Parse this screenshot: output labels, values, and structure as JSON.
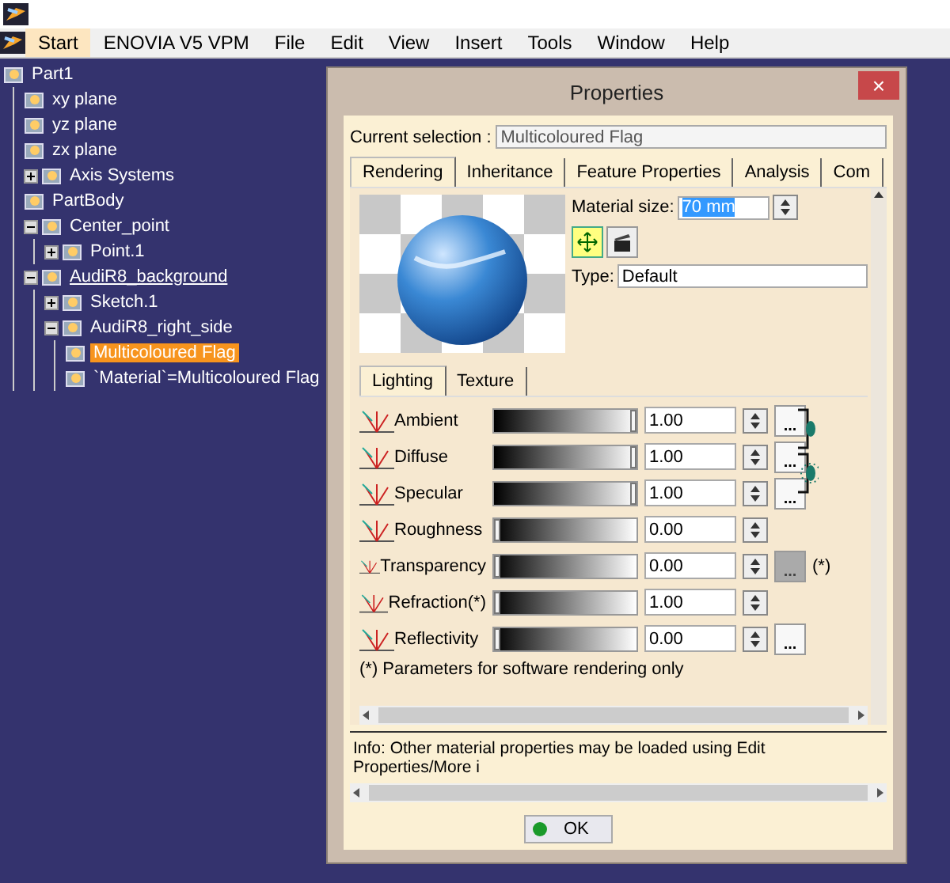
{
  "menubar": {
    "items": [
      {
        "label": "Start",
        "selected": true
      },
      {
        "label": "ENOVIA V5 VPM",
        "selected": false
      },
      {
        "label": "File",
        "selected": false
      },
      {
        "label": "Edit",
        "selected": false
      },
      {
        "label": "View",
        "selected": false
      },
      {
        "label": "Insert",
        "selected": false
      },
      {
        "label": "Tools",
        "selected": false
      },
      {
        "label": "Window",
        "selected": false
      },
      {
        "label": "Help",
        "selected": false
      }
    ]
  },
  "tree": [
    {
      "label": "Part1",
      "selected": false,
      "underlined": false,
      "children": [
        {
          "label": "xy plane",
          "selected": false,
          "underlined": false
        },
        {
          "label": "yz plane",
          "selected": false,
          "underlined": false
        },
        {
          "label": "zx plane",
          "selected": false,
          "underlined": false
        },
        {
          "label": "Axis Systems",
          "selected": false,
          "underlined": false,
          "expanded": false
        },
        {
          "label": "PartBody",
          "selected": false,
          "underlined": false
        },
        {
          "label": "Center_point",
          "selected": false,
          "underlined": false,
          "expanded": true,
          "children": [
            {
              "label": "Point.1",
              "selected": false,
              "underlined": false,
              "expanded": false
            }
          ]
        },
        {
          "label": "AudiR8_background",
          "selected": false,
          "underlined": true,
          "expanded": true,
          "children": [
            {
              "label": "Sketch.1",
              "selected": false,
              "underlined": false,
              "expanded": false
            },
            {
              "label": "AudiR8_right_side",
              "selected": false,
              "underlined": false,
              "expanded": true,
              "children": [
                {
                  "label": "Multicoloured Flag",
                  "selected": true,
                  "underlined": false
                },
                {
                  "label": "`Material`=Multicoloured Flag",
                  "selected": false,
                  "underlined": false
                }
              ]
            }
          ]
        }
      ]
    }
  ],
  "dialog": {
    "title": "Properties",
    "close": "×",
    "current_selection": {
      "label": "Current selection :",
      "value": "Multicoloured Flag"
    },
    "tabs": [
      {
        "label": "Rendering",
        "selected": true
      },
      {
        "label": "Inheritance",
        "selected": false
      },
      {
        "label": "Feature Properties",
        "selected": false
      },
      {
        "label": "Analysis",
        "selected": false
      },
      {
        "label": "Com",
        "selected": false
      }
    ],
    "material_size": {
      "label": "Material size:",
      "value": "70 mm",
      "value_selected": true
    },
    "type": {
      "label": "Type:",
      "value": "Default"
    },
    "subtabs": [
      {
        "label": "Lighting",
        "selected": true
      },
      {
        "label": "Texture",
        "selected": false
      }
    ],
    "lighting": [
      {
        "name": "Ambient",
        "level": 1,
        "value": "1.00",
        "button": {
          "label": "...",
          "disabled": false
        }
      },
      {
        "name": "Diffuse",
        "level": 1,
        "value": "1.00",
        "button": {
          "label": "...",
          "disabled": false
        }
      },
      {
        "name": "Specular",
        "level": 1,
        "value": "1.00",
        "button": {
          "label": "...",
          "disabled": false
        }
      },
      {
        "name": "Roughness",
        "level": 0,
        "value": "0.00"
      },
      {
        "name": "Transparency",
        "level": 0,
        "value": "0.00",
        "button": {
          "label": "...",
          "disabled": true
        },
        "note": "(*)"
      },
      {
        "name": "Refraction(*)",
        "level": 0,
        "value": "1.00"
      },
      {
        "name": "Reflectivity",
        "level": 0,
        "value": "0.00",
        "button": {
          "label": "...",
          "disabled": false
        }
      }
    ],
    "footnote": "(*) Parameters for software rendering only",
    "info": "Info: Other material properties may be loaded using Edit Properties/More i",
    "ok_button": "OK"
  }
}
